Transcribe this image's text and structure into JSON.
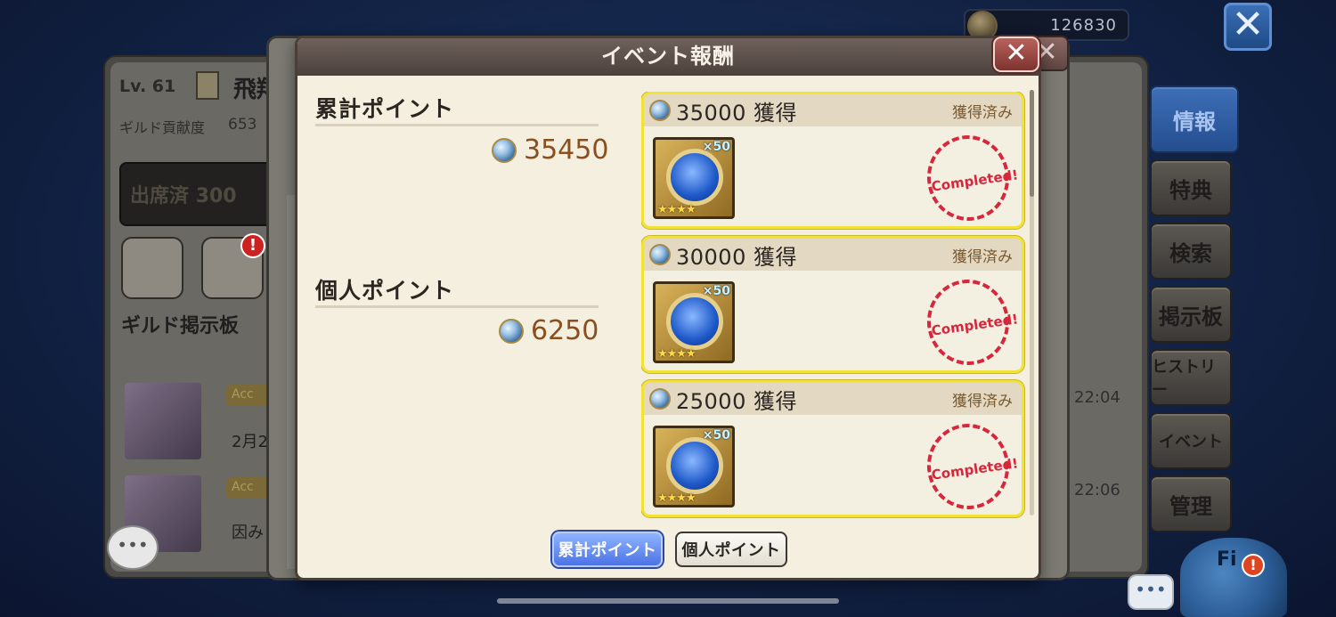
{
  "top": {
    "currency_value": "126830"
  },
  "side_tabs": [
    "情報",
    "特典",
    "検索",
    "掲示板",
    "ヒストリー",
    "イベント",
    "管理"
  ],
  "background": {
    "level": "Lv. 61",
    "name": "飛翔",
    "contribution_label": "ギルド貢献度",
    "contribution_value": "653",
    "attended_label": "出席済",
    "attended_value": "300",
    "board_title": "ギルド掲示板",
    "rows": [
      {
        "acc": "Acc",
        "text": "2月2",
        "time": "22:04"
      },
      {
        "acc": "Acc",
        "text": "因み",
        "time": "22:06"
      }
    ],
    "mascot_text": "Fi"
  },
  "dialog": {
    "title": "イベント報酬",
    "total_label": "累計ポイント",
    "total_value": "35450",
    "personal_label": "個人ポイント",
    "personal_value": "6250",
    "rewards": [
      {
        "threshold": "35000 獲得",
        "status": "獲得済み",
        "qty": "×50",
        "stars": "★★★★",
        "stamp": "Completed!"
      },
      {
        "threshold": "30000 獲得",
        "status": "獲得済み",
        "qty": "×50",
        "stars": "★★★★",
        "stamp": "Completed!"
      },
      {
        "threshold": "25000 獲得",
        "status": "獲得済み",
        "qty": "×50",
        "stars": "★★★★",
        "stamp": "Completed!"
      }
    ],
    "tabs": {
      "total": "累計ポイント",
      "personal": "個人ポイント"
    }
  },
  "colors": {
    "accent_gold": "#f2e234",
    "value_brown": "#8a4f1e",
    "active_tab_blue": "#4c73e6",
    "stamp_red": "#d6283d"
  }
}
